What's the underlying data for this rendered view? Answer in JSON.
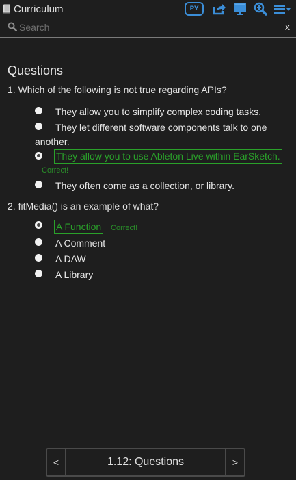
{
  "header": {
    "title": "Curriculum",
    "language_badge": "PY",
    "icons": [
      "book-icon",
      "share-icon",
      "present-icon",
      "zoom-in-icon",
      "menu-dropdown-icon"
    ]
  },
  "search": {
    "placeholder": "Search",
    "clear_label": "x"
  },
  "main": {
    "section_title": "Questions",
    "questions": [
      {
        "text": "1. Which of the following is not true regarding APIs?",
        "options": [
          {
            "label_line1": "They allow you to simplify complex coding tasks.",
            "checked": false
          },
          {
            "label_line1": "They let different software components talk to one",
            "label_line2": "another.",
            "checked": false
          },
          {
            "label_line1": "They allow you to use Ableton Live within EarSketch.",
            "checked": true,
            "feedback": "Correct!"
          },
          {
            "label_line1": "They often come as a collection, or library.",
            "checked": false
          }
        ]
      },
      {
        "text": "2. fitMedia() is an example of what?",
        "options": [
          {
            "label_line1": "A Function",
            "checked": true,
            "feedback": "Correct!"
          },
          {
            "label_line1": "A Comment",
            "checked": false
          },
          {
            "label_line1": "A DAW",
            "checked": false
          },
          {
            "label_line1": "A Library",
            "checked": false
          }
        ]
      }
    ]
  },
  "footer": {
    "prev_label": "<",
    "next_label": ">",
    "current_page": "1.12: Questions"
  },
  "colors": {
    "background": "#1e1e1e",
    "accent_blue": "#3b8ed8",
    "correct_green": "#2aa12a"
  }
}
